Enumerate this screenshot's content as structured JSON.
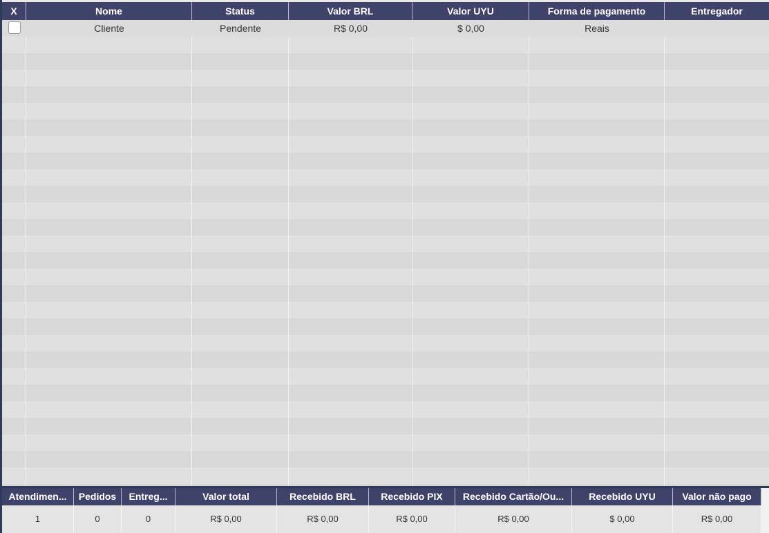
{
  "orders_table": {
    "columns": [
      "X",
      "Nome",
      "Status",
      "Valor BRL",
      "Valor UYU",
      "Forma de pagamento",
      "Entregador"
    ],
    "rows": [
      {
        "selected": false,
        "nome": "Cliente",
        "status": "Pendente",
        "valor_brl": "R$ 0,00",
        "valor_uyu": "$ 0,00",
        "forma_pagamento": "Reais",
        "entregador": ""
      }
    ]
  },
  "summary_table": {
    "columns": [
      "Atendimen...",
      "Pedidos",
      "Entreg...",
      "Valor total",
      "Recebido BRL",
      "Recebido PIX",
      "Recebido Cartão/Ou...",
      "Recebido UYU",
      "Valor não pago"
    ],
    "values": [
      "1",
      "0",
      "0",
      "R$ 0,00",
      "R$ 0,00",
      "R$ 0,00",
      "R$ 0,00",
      "$ 0,00",
      "R$ 0,00"
    ]
  },
  "colors": {
    "header_bg": "#3f4369",
    "frame": "#2e3a57",
    "row_light": "#e0e0e0",
    "row_dark": "#d8d8d8"
  }
}
